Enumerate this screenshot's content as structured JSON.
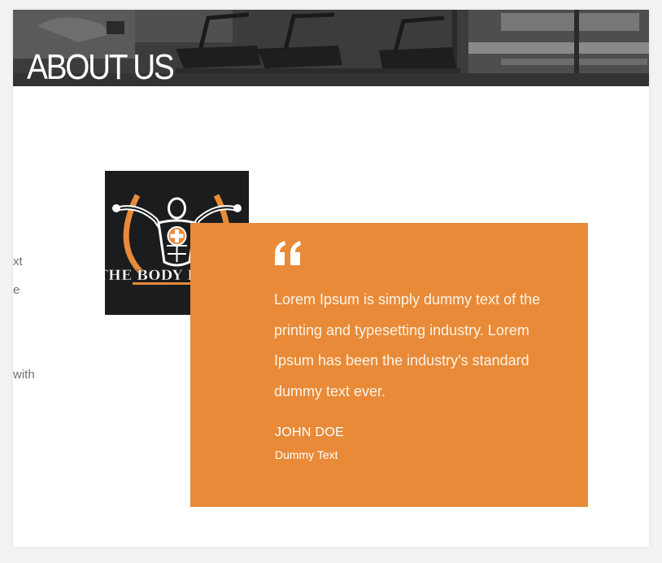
{
  "hero": {
    "title": "ABOUT US"
  },
  "side_text": [
    "xt",
    "e",
    "with"
  ],
  "logo": {
    "text": "THE BODY DOCTOR",
    "accent_color": "#e88a38",
    "background": "#1b1c1e"
  },
  "testimonial": {
    "quote_icon": "quote-icon",
    "text": "Lorem Ipsum is simply dummy text of the printing and typesetting industry. Lorem Ipsum has been the industry's standard dummy text ever.",
    "author": "JOHN DOE",
    "role": "Dummy Text",
    "background": "#e88a38"
  }
}
